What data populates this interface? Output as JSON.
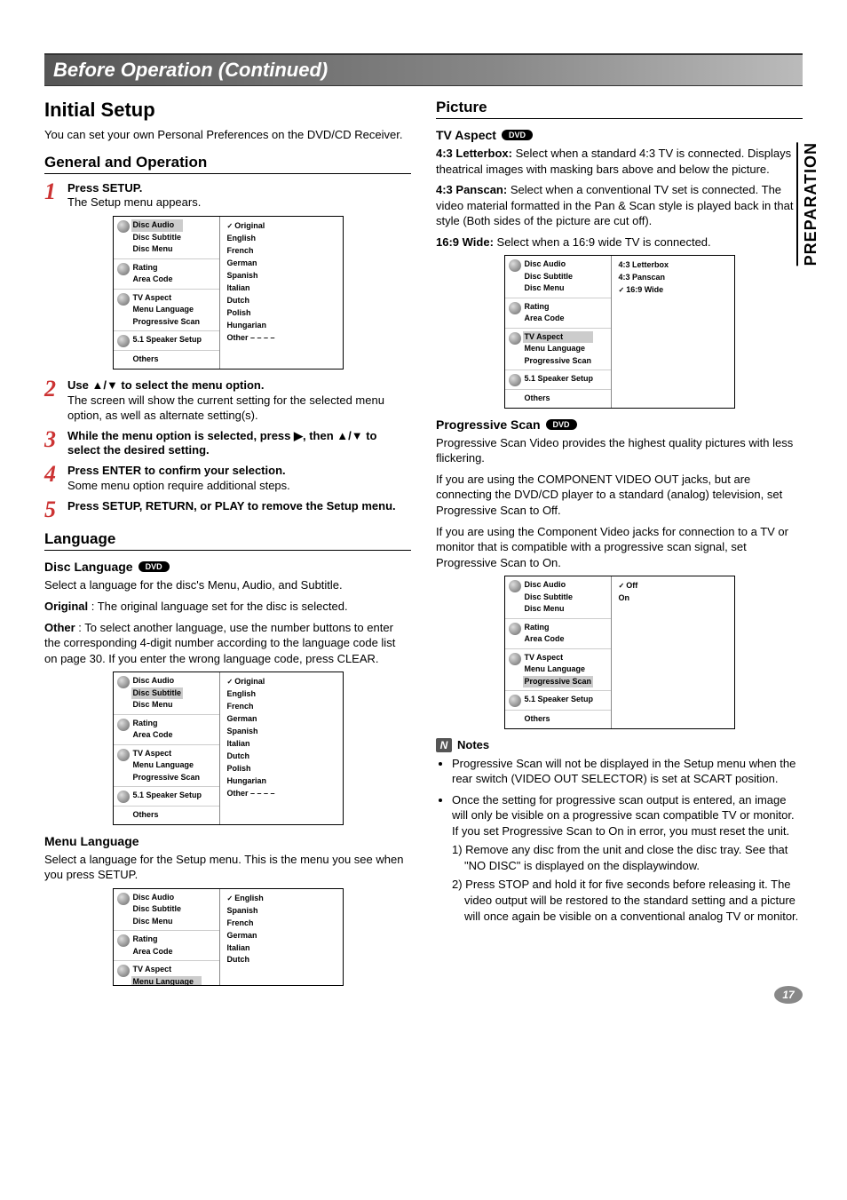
{
  "sideTab": "PREPARATION",
  "pageNumber": "17",
  "header": {
    "title": "Before Operation (Continued)"
  },
  "left": {
    "h2": "Initial Setup",
    "intro": "You can set your own Personal Preferences on the DVD/CD Receiver.",
    "general": {
      "heading": "General and Operation",
      "steps": [
        {
          "n": "1",
          "t": "Press SETUP.",
          "b": "The Setup menu appears."
        },
        {
          "n": "2",
          "t": "Use ▲/▼ to select the menu option.",
          "b": "The screen will show the current setting for the selected menu option, as well as alternate setting(s)."
        },
        {
          "n": "3",
          "t": "While the menu option is selected, press ▶, then ▲/▼ to select the desired setting.",
          "b": ""
        },
        {
          "n": "4",
          "t": "Press ENTER to confirm your selection.",
          "b": "Some menu option require additional steps."
        },
        {
          "n": "5",
          "t": "Press SETUP, RETURN, or PLAY to remove the Setup menu.",
          "b": ""
        }
      ]
    },
    "language": {
      "heading": "Language",
      "disc": {
        "title": "Disc Language",
        "pill": "DVD",
        "p1": "Select a language for the disc's Menu, Audio, and Subtitle.",
        "p2a": "Original",
        "p2b": " : The original language set for the disc is selected.",
        "p3a": "Other",
        "p3b": " : To select another language, use the number buttons to enter the corresponding 4-digit number according to the language code list on page 30. If you enter the wrong language code, press CLEAR."
      },
      "menu": {
        "title": "Menu Language",
        "p": "Select a language for the Setup menu. This is the menu you see when you press SETUP."
      }
    }
  },
  "right": {
    "picture": {
      "heading": "Picture",
      "tv": {
        "title": "TV Aspect",
        "pill": "DVD",
        "p1a": "4:3 Letterbox:",
        "p1b": " Select when a standard 4:3 TV is connected. Displays theatrical images with masking bars above and below the picture.",
        "p2a": "4:3 Panscan:",
        "p2b": " Select when a conventional TV set is connected. The video material formatted in the Pan & Scan style is played back in that style (Both sides of the picture are cut off).",
        "p3a": "16:9 Wide:",
        "p3b": " Select when a 16:9 wide TV is connected."
      },
      "ps": {
        "title": "Progressive Scan",
        "pill": "DVD",
        "p1": "Progressive Scan Video provides the highest quality pictures with less flickering.",
        "p2": "If you are using the COMPONENT VIDEO OUT jacks, but are connecting the DVD/CD player to a standard (analog) television, set Progressive Scan to Off.",
        "p3": "If you are using the Component Video jacks for connection to a TV or monitor that is compatible with a progressive scan signal, set Progressive Scan to On."
      }
    },
    "notes": {
      "label": "Notes",
      "b1": "Progressive Scan will not be displayed in the Setup menu when the rear switch (VIDEO OUT SELECTOR) is set at SCART position.",
      "b2": "Once the setting for progressive scan output is entered, an image will only be visible on a progressive scan compatible TV or monitor. If you set Progressive Scan to On in error, you must reset the unit.",
      "s1": "1) Remove any disc from the unit and close the disc tray. See that \"NO DISC\" is displayed on the displaywindow.",
      "s2": "2) Press STOP and hold it for five seconds before releasing it. The video output will be restored to the standard setting and a picture will once again be visible on a conventional analog TV or monitor."
    }
  },
  "osd": {
    "leftGroups": [
      {
        "items": [
          "Disc Audio",
          "Disc Subtitle",
          "Disc Menu"
        ]
      },
      {
        "items": [
          "Rating",
          "Area Code"
        ]
      },
      {
        "items": [
          "TV Aspect",
          "Menu Language",
          "Progressive Scan"
        ]
      },
      {
        "items": [
          "5.1 Speaker Setup"
        ]
      },
      {
        "items": [
          "Others"
        ]
      }
    ],
    "discLangOpts": [
      "Original",
      "English",
      "French",
      "German",
      "Spanish",
      "Italian",
      "Dutch",
      "Polish",
      "Hungarian",
      "Other  – – – –"
    ],
    "menuLangOpts": [
      "English",
      "Spanish",
      "French",
      "German",
      "Italian",
      "Dutch"
    ],
    "tvOpts": [
      "4:3   Letterbox",
      "4:3   Panscan",
      "16:9 Wide"
    ],
    "psOpts": [
      "Off",
      "On"
    ]
  }
}
